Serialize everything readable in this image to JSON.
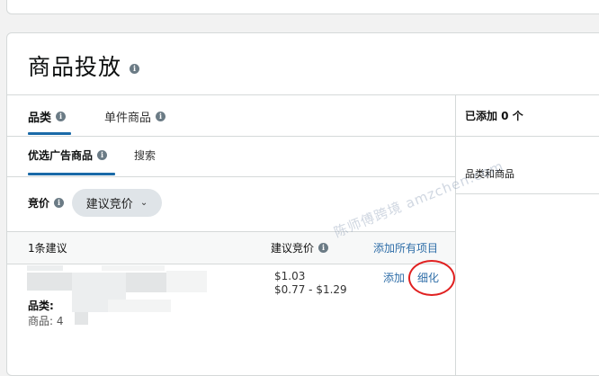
{
  "page": {
    "title": "商品投放",
    "main_tabs": [
      {
        "label": "品类",
        "active": true
      },
      {
        "label": "单件商品",
        "active": false
      }
    ],
    "sub_tabs": [
      {
        "label": "优选广告商品",
        "active": true
      },
      {
        "label": "搜索",
        "active": false
      }
    ],
    "bid": {
      "label": "竞价",
      "dropdown_value": "建议竞价"
    },
    "list_header": {
      "count_label": "1条建议",
      "suggested_bid_label": "建议竞价",
      "add_all_link": "添加所有项目"
    },
    "suggestion_row": {
      "category_prefix": "品类:",
      "product_prefix": "商品: 4",
      "bid_value": "$1.03",
      "bid_range": "$0.77 - $1.29",
      "add_link": "添加",
      "refine_link": "细化"
    },
    "right_panel": {
      "added_label": "已添加 0 个",
      "column_label": "品类和商品"
    },
    "watermark": "陈师傅跨境 amzchen.com",
    "colors": {
      "accent": "#1a6aa8",
      "link": "#2f6ea8",
      "highlight_circle": "#e02020"
    }
  }
}
